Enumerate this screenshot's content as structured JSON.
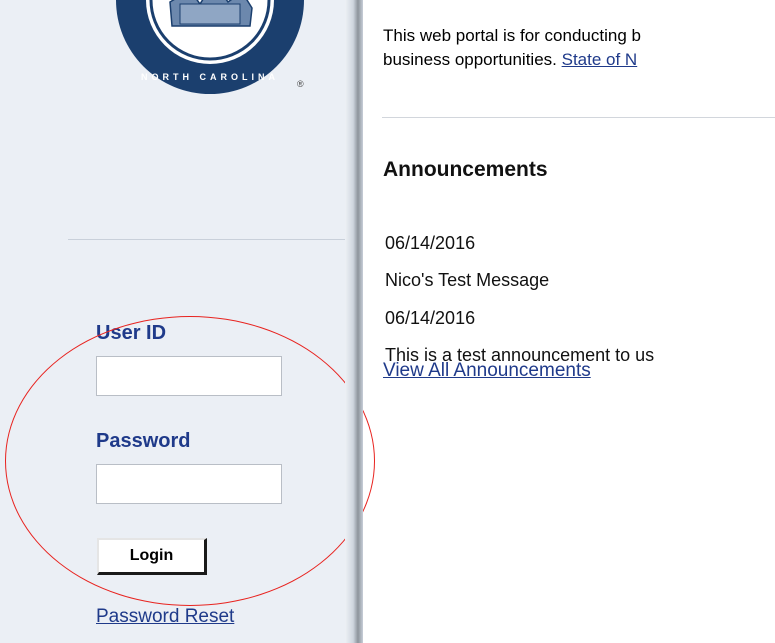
{
  "seal": {
    "text_top": "",
    "text_bottom": "NORTH CAROLINA",
    "registered_mark": "®"
  },
  "login": {
    "user_id_label": "User ID",
    "user_id_value": "",
    "password_label": "Password",
    "password_value": "",
    "login_button": "Login",
    "password_reset_link": "Password Reset"
  },
  "main": {
    "intro_line1": "This web portal is for conducting b",
    "intro_line2_text": "business opportunities. ",
    "intro_line2_link": "State of N",
    "announcements_heading": "Announcements",
    "announcements": [
      {
        "date": "06/14/2016",
        "text": "Nico's Test Message"
      },
      {
        "date": "06/14/2016",
        "text": "This is a test announcement to us"
      }
    ],
    "view_all_link": "View All Announcements"
  },
  "colors": {
    "sidebar_bg": "#ebeff5",
    "label_blue": "#1f3a8a",
    "seal_navy": "#1b3f6e",
    "annotation_red": "#e8231f"
  },
  "icons": {
    "seal": "nc-state-seal-icon"
  }
}
